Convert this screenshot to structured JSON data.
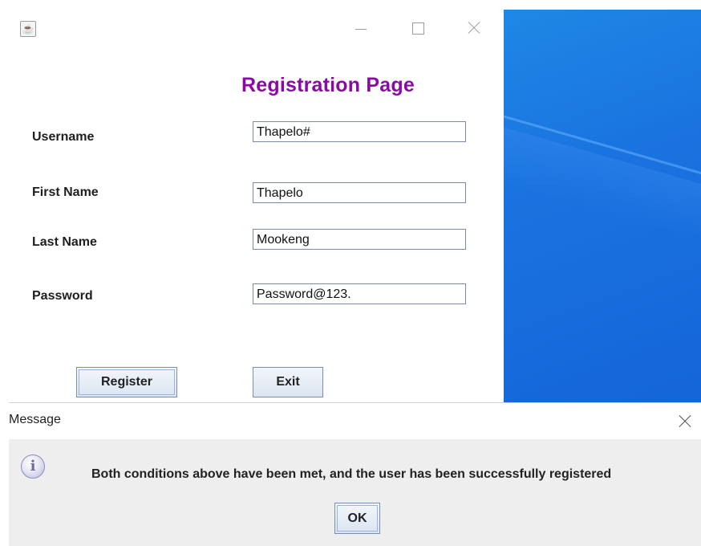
{
  "registration_window": {
    "icon": "java-cup-icon",
    "title_text": "Registration Page",
    "fields": {
      "username": {
        "label": "Username",
        "value": "Thapelo#"
      },
      "first_name": {
        "label": "First Name",
        "value": "Thapelo"
      },
      "last_name": {
        "label": "Last Name",
        "value": "Mookeng"
      },
      "password": {
        "label": "Password",
        "value": "Password@123."
      }
    },
    "buttons": {
      "register": "Register",
      "exit": "Exit"
    }
  },
  "message_dialog": {
    "title": "Message",
    "icon": "information-icon",
    "message": "Both conditions above have been met, and the user has been successfully registered",
    "ok_label": "OK"
  },
  "colors": {
    "title_purple": "#8b0aa5",
    "desktop_blue": "#1a73e0",
    "dialog_bg": "#eeeeee"
  }
}
